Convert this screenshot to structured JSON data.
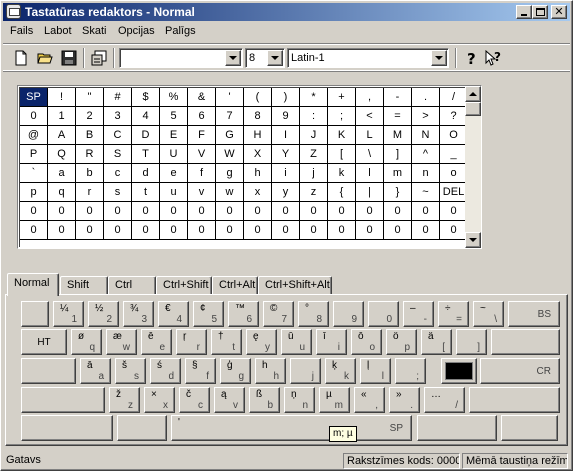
{
  "window": {
    "title": "Tastatūras redaktors - Normal"
  },
  "menu": [
    {
      "label": "Fails"
    },
    {
      "label": "Labot"
    },
    {
      "label": "Skati"
    },
    {
      "label": "Opcijas"
    },
    {
      "label": "Palīgs"
    }
  ],
  "toolbar": {
    "font_value": "",
    "size_value": "8",
    "charset_value": "Latin-1",
    "icons": [
      "new-file-icon",
      "open-folder-icon",
      "save-icon",
      "properties-icon",
      "help-icon",
      "context-help-icon"
    ]
  },
  "char_grid": {
    "rows": [
      [
        "SP",
        "!",
        "\"",
        "#",
        "$",
        "%",
        "&",
        "'",
        "(",
        ")",
        "*",
        "+",
        ",",
        "-",
        ".",
        "/"
      ],
      [
        "0",
        "1",
        "2",
        "3",
        "4",
        "5",
        "6",
        "7",
        "8",
        "9",
        ":",
        ";",
        "<",
        "=",
        ">",
        "?"
      ],
      [
        "@",
        "A",
        "B",
        "C",
        "D",
        "E",
        "F",
        "G",
        "H",
        "I",
        "J",
        "K",
        "L",
        "M",
        "N",
        "O"
      ],
      [
        "P",
        "Q",
        "R",
        "S",
        "T",
        "U",
        "V",
        "W",
        "X",
        "Y",
        "Z",
        "[",
        "\\",
        "]",
        "^",
        "_"
      ],
      [
        "`",
        "a",
        "b",
        "c",
        "d",
        "e",
        "f",
        "g",
        "h",
        "i",
        "j",
        "k",
        "l",
        "m",
        "n",
        "o"
      ],
      [
        "p",
        "q",
        "r",
        "s",
        "t",
        "u",
        "v",
        "w",
        "x",
        "y",
        "z",
        "{",
        "|",
        "}",
        "~",
        "DEL"
      ],
      [
        "0",
        "0",
        "0",
        "0",
        "0",
        "0",
        "0",
        "0",
        "0",
        "0",
        "0",
        "0",
        "0",
        "0",
        "0",
        "0"
      ],
      [
        "0",
        "0",
        "0",
        "0",
        "0",
        "0",
        "0",
        "0",
        "0",
        "0",
        "0",
        "0",
        "0",
        "0",
        "0",
        "0"
      ]
    ],
    "selected": "SP"
  },
  "tabs": [
    {
      "label": "Normal",
      "active": true
    },
    {
      "label": "Shift"
    },
    {
      "label": "Ctrl"
    },
    {
      "label": "Ctrl+Shift"
    },
    {
      "label": "Ctrl+Alt"
    },
    {
      "label": "Ctrl+Shift+Alt"
    }
  ],
  "keyboard": {
    "rows": [
      [
        {
          "tl": "",
          "br": ""
        },
        {
          "tl": "¼",
          "br": "1"
        },
        {
          "tl": "½",
          "br": "2"
        },
        {
          "tl": "¾",
          "br": "3"
        },
        {
          "tl": "€",
          "br": "4"
        },
        {
          "tl": "¢",
          "br": "5"
        },
        {
          "tl": "™",
          "br": "6"
        },
        {
          "tl": "©",
          "br": "7"
        },
        {
          "tl": "°",
          "br": "8"
        },
        {
          "tl": "",
          "br": "9"
        },
        {
          "tl": "",
          "br": "0"
        },
        {
          "tl": "–",
          "br": "-"
        },
        {
          "tl": "÷",
          "br": "="
        },
        {
          "tl": "~",
          "br": "\\"
        },
        {
          "label": "BS"
        }
      ],
      [
        {
          "label": "HT"
        },
        {
          "tl": "ø",
          "br": "q"
        },
        {
          "tl": "æ",
          "br": "w"
        },
        {
          "tl": "ē",
          "br": "e"
        },
        {
          "tl": "ŗ",
          "br": "r"
        },
        {
          "tl": "†",
          "br": "t"
        },
        {
          "tl": "ę",
          "br": "y"
        },
        {
          "tl": "ū",
          "br": "u"
        },
        {
          "tl": "ī",
          "br": "i"
        },
        {
          "tl": "ō",
          "br": "o"
        },
        {
          "tl": "ö",
          "br": "p"
        },
        {
          "tl": "ä",
          "br": "["
        },
        {
          "tl": "",
          "br": "]"
        },
        {
          "tl": "",
          "br": ""
        }
      ],
      [
        {
          "tl": "",
          "br": ""
        },
        {
          "tl": "ā",
          "br": "a"
        },
        {
          "tl": "š",
          "br": "s"
        },
        {
          "tl": "ś",
          "br": "d"
        },
        {
          "tl": "§",
          "br": "f"
        },
        {
          "tl": "ģ",
          "br": "g"
        },
        {
          "tl": "h",
          "br": "h"
        },
        {
          "tl": "",
          "br": "j"
        },
        {
          "tl": "ķ",
          "br": "k"
        },
        {
          "tl": "ļ",
          "br": "l"
        },
        {
          "tl": "",
          "br": ";"
        },
        {
          "tl": "",
          "br": ""
        },
        {
          "label": "CR"
        }
      ],
      [
        {
          "tl": "",
          "br": ""
        },
        {
          "tl": "ž",
          "br": "z"
        },
        {
          "tl": "×",
          "br": "x"
        },
        {
          "tl": "č",
          "br": "c"
        },
        {
          "tl": "ą",
          "br": "v"
        },
        {
          "tl": "ß",
          "br": "b"
        },
        {
          "tl": "ņ",
          "br": "n"
        },
        {
          "tl": "µ",
          "br": "m"
        },
        {
          "tl": "«",
          "br": ","
        },
        {
          "tl": "»",
          "br": "."
        },
        {
          "tl": "…",
          "br": "/"
        },
        {
          "tl": "",
          "br": ""
        }
      ],
      [
        {
          "tl": "",
          "br": ""
        },
        {
          "tl": "",
          "br": ""
        },
        {
          "tl": "'",
          "label": "SP"
        },
        {
          "tl": "",
          "br": ""
        },
        {
          "tl": "",
          "br": ""
        }
      ]
    ],
    "tooltip": "m; µ"
  },
  "status": {
    "left": "Gatavs",
    "code": "Rakstzīmes kods: 0000",
    "mode": "Mēmā taustiņa režīms"
  }
}
